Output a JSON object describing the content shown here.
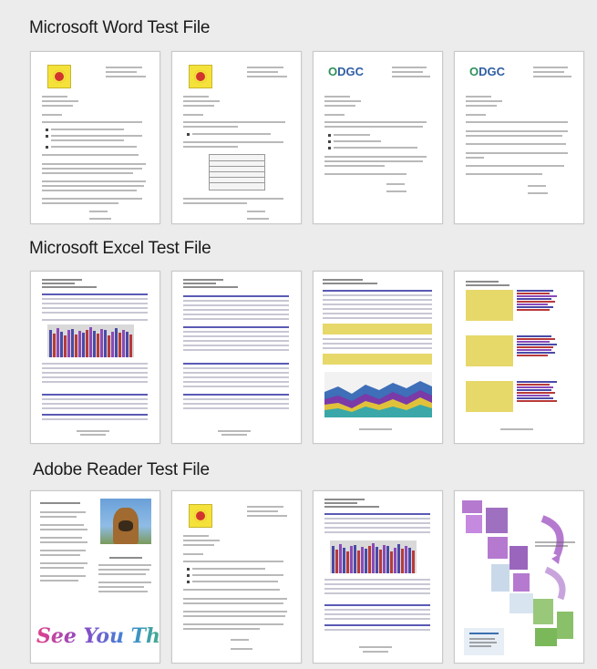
{
  "sections": [
    {
      "title": "Microsoft Word Test File"
    },
    {
      "title": "Microsoft Excel Test File"
    },
    {
      "title": "Adobe Reader Test File"
    }
  ],
  "adobe": {
    "see_you_there": "See You There!!!"
  },
  "colors": {
    "background": "#ececec",
    "bar_blue": "#4a4aa8",
    "bar_red": "#b83a3a",
    "bar_purple": "#8a4ab8",
    "highlight": "#e7d86a"
  }
}
